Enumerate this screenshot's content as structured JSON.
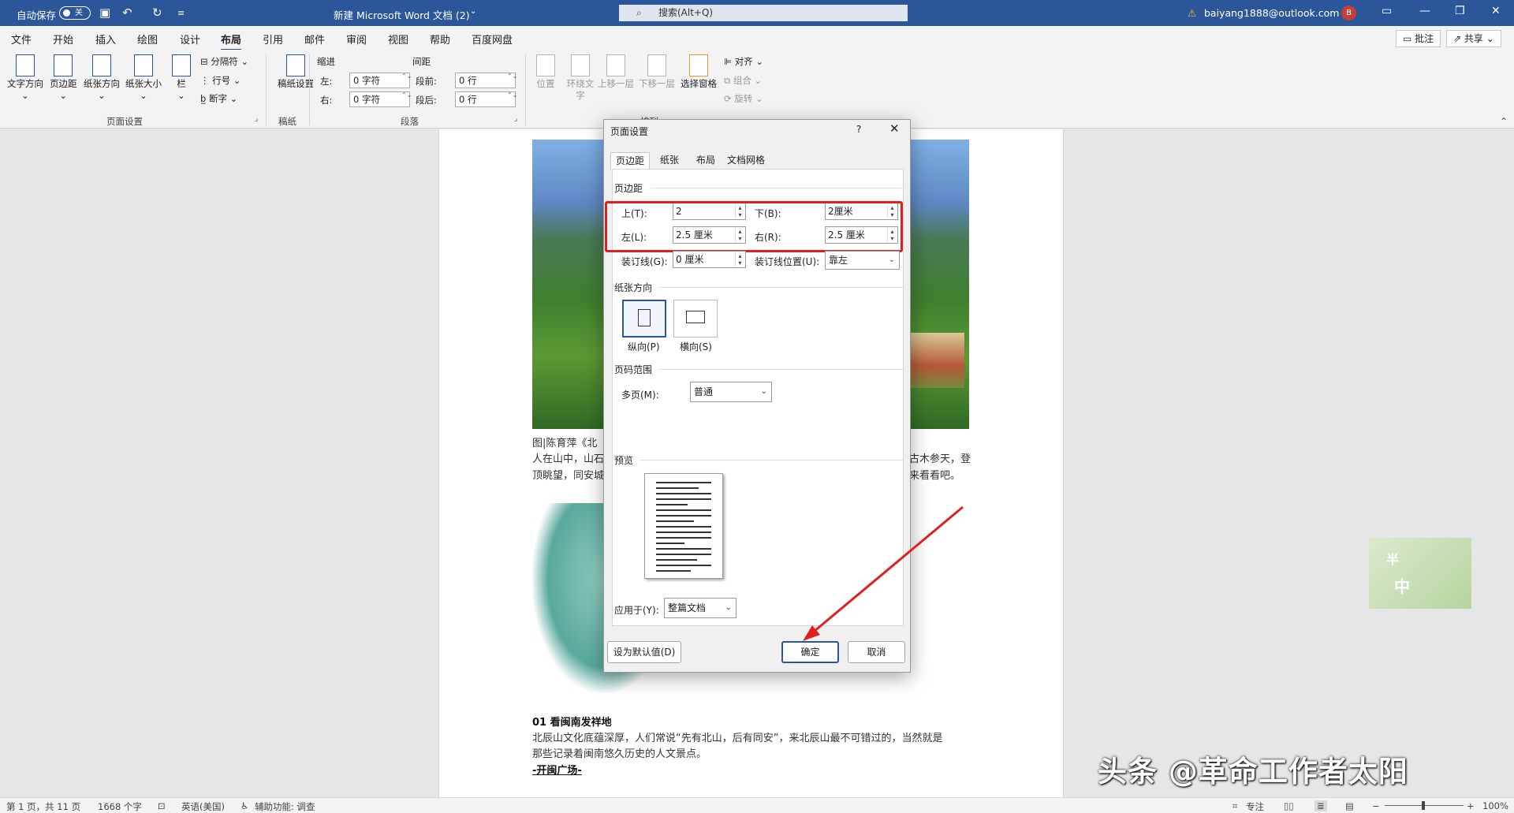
{
  "titlebar": {
    "autosave_label": "自动保存",
    "autosave_state": "关",
    "doc_title": "新建 Microsoft Word 文档 (2)",
    "search_placeholder": "搜索(Alt+Q)",
    "account": "baiyang1888@outlook.com",
    "avatar_letter": "B",
    "qat_icons": [
      "save-icon",
      "undo-icon",
      "redo-icon",
      "customize-icon"
    ],
    "window_buttons": [
      "ribbon-display-icon",
      "minimize-icon",
      "restore-icon",
      "close-icon"
    ]
  },
  "menu": {
    "tabs": [
      "文件",
      "开始",
      "插入",
      "绘图",
      "设计",
      "布局",
      "引用",
      "邮件",
      "审阅",
      "视图",
      "帮助",
      "百度网盘"
    ],
    "active_tab": "布局",
    "comment_button": "批注",
    "share_button": "共享"
  },
  "ribbon": {
    "page_setup": {
      "group_label": "页面设置",
      "text_direction": "文字方向",
      "margins": "页边距",
      "orientation": "纸张方向",
      "size": "纸张大小",
      "columns": "栏",
      "breaks": "分隔符",
      "line_numbers": "行号",
      "hyphenation": "断字"
    },
    "manuscript": {
      "group_label": "稿纸",
      "button": "稿纸设置"
    },
    "paragraph": {
      "group_label": "段落",
      "indent_label": "缩进",
      "spacing_label": "间距",
      "indent_left_label": "左:",
      "indent_left_value": "0 字符",
      "indent_right_label": "右:",
      "indent_right_value": "0 字符",
      "spacing_before_label": "段前:",
      "spacing_before_value": "0 行",
      "spacing_after_label": "段后:",
      "spacing_after_value": "0 行"
    },
    "arrange": {
      "group_label": "排列",
      "position": "位置",
      "wrap_text": "环绕文字",
      "bring_forward": "上移一层",
      "send_backward": "下移一层",
      "selection_pane": "选择窗格",
      "align": "对齐",
      "group": "组合",
      "rotate": "旋转"
    }
  },
  "document": {
    "caption": "图|陈育萍《北",
    "para1_left": "人在山中，山石",
    "para1_right": "古木参天，登",
    "para2_left": "顶眺望，同安城",
    "para2_right": "来看看吧。",
    "heading": "01  看闽南发祥地",
    "body_line1": "北辰山文化底蕴深厚，人们常说“先有北山，后有同安”，来北辰山最不可错过的，当然就是",
    "body_line2": "那些记录着闽南悠久历史的人文景点。",
    "subheading": "-开闽广场-"
  },
  "dialog": {
    "title": "页面设置",
    "help": "?",
    "tabs": [
      "页边距",
      "纸张",
      "布局",
      "文档网格"
    ],
    "active_tab": "页边距",
    "margins_section": "页边距",
    "top_label": "上(T):",
    "top_value": "2",
    "bottom_label": "下(B):",
    "bottom_value": "2厘米",
    "left_label": "左(L):",
    "left_value": "2.5 厘米",
    "right_label": "右(R):",
    "right_value": "2.5 厘米",
    "gutter_label": "装订线(G):",
    "gutter_value": "0 厘米",
    "gutter_pos_label": "装订线位置(U):",
    "gutter_pos_value": "靠左",
    "orientation_section": "纸张方向",
    "portrait_label": "纵向(P)",
    "landscape_label": "横向(S)",
    "pages_section": "页码范围",
    "multiple_pages_label": "多页(M):",
    "multiple_pages_value": "普通",
    "preview_section": "预览",
    "apply_to_label": "应用于(Y):",
    "apply_to_value": "整篇文档",
    "default_button": "设为默认值(D)",
    "ok_button": "确定",
    "cancel_button": "取消"
  },
  "watermark": {
    "text": "头条 @革命工作者太阳",
    "stamp_chars": [
      "半",
      "中"
    ]
  },
  "statusbar": {
    "page": "第 1 页，共 11 页",
    "words": "1668 个字",
    "language": "英语(美国)",
    "accessibility": "辅助功能: 调查",
    "focus": "专注",
    "zoom": "100%"
  },
  "colors": {
    "title_bar": "#2b579a",
    "highlight_box": "#e02020",
    "arrow": "#e02020"
  }
}
